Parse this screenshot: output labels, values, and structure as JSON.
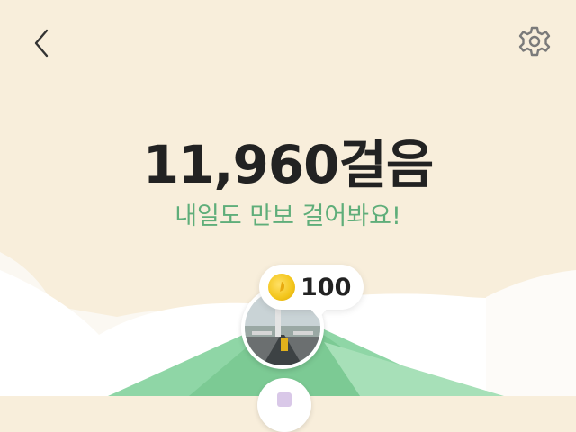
{
  "header": {
    "back_icon": "chevron-left-icon",
    "settings_icon": "gear-icon"
  },
  "steps": {
    "count": "11,960걸음"
  },
  "message": "내일도 만보 걸어봐요!",
  "reward": {
    "amount": "100",
    "coin_icon": "coin-icon"
  },
  "colors": {
    "background": "#f8eedb",
    "accent_green": "#5fae7a",
    "mountain_green": "#7fcf98"
  }
}
